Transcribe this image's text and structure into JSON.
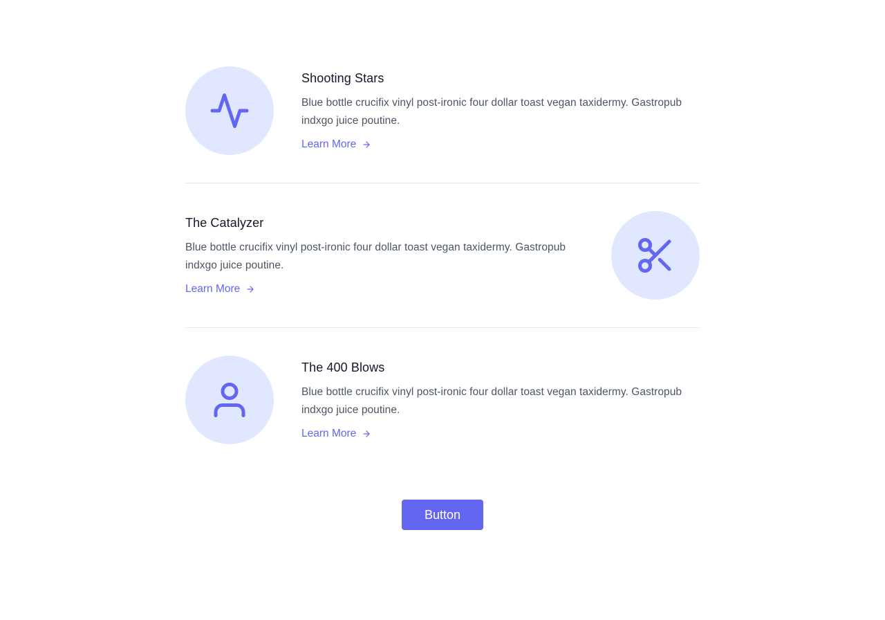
{
  "colors": {
    "accent": "#6366f1",
    "icon_bg": "#e0e7ff",
    "title": "#111827",
    "text": "#4b5563",
    "divider": "#e5e7eb"
  },
  "features": [
    {
      "title": "Shooting Stars",
      "description": "Blue bottle crucifix vinyl post-ironic four dollar toast vegan taxidermy. Gastropub indxgo juice poutine.",
      "link_label": "Learn More",
      "icon": "pulse-icon"
    },
    {
      "title": "The Catalyzer",
      "description": "Blue bottle crucifix vinyl post-ironic four dollar toast vegan taxidermy. Gastropub indxgo juice poutine.",
      "link_label": "Learn More",
      "icon": "scissors-icon"
    },
    {
      "title": "The 400 Blows",
      "description": "Blue bottle crucifix vinyl post-ironic four dollar toast vegan taxidermy. Gastropub indxgo juice poutine.",
      "link_label": "Learn More",
      "icon": "user-icon"
    }
  ],
  "button": {
    "label": "Button"
  }
}
